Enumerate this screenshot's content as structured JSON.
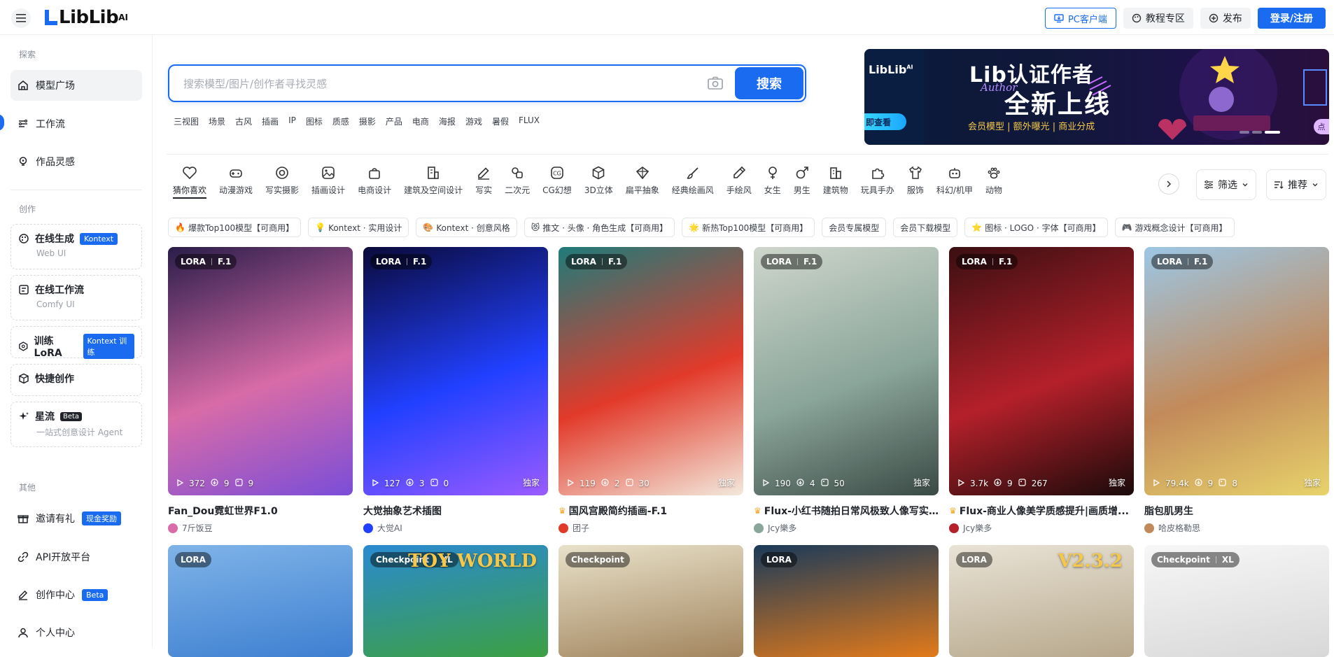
{
  "header": {
    "logo": "LibLib",
    "logo_suffix": "AI",
    "pc_client": "PC客户端",
    "tutorial": "教程专区",
    "publish": "发布",
    "login": "登录/注册"
  },
  "sidebar": {
    "section_search": "探索",
    "section_create": "创作",
    "section_other": "其他",
    "explore": [
      {
        "label": "模型广场",
        "icon": "home-icon"
      },
      {
        "label": "工作流",
        "icon": "workflow-icon"
      },
      {
        "label": "作品灵感",
        "icon": "lightbulb-icon"
      }
    ],
    "create": [
      {
        "label": "在线生成",
        "badge": "Kontext",
        "sub": "Web UI"
      },
      {
        "label": "在线工作流",
        "sub": "Comfy UI"
      },
      {
        "label": "训练LoRA",
        "badge": "Kontext 训练"
      },
      {
        "label": "快捷创作"
      },
      {
        "label": "星流",
        "badge": "Beta",
        "sub": "一站式创意设计 Agent"
      }
    ],
    "other": [
      {
        "label": "邀请有礼",
        "badge": "现金奖励"
      },
      {
        "label": "API开放平台"
      },
      {
        "label": "创作中心",
        "badge": "Beta"
      },
      {
        "label": "个人中心"
      }
    ]
  },
  "search": {
    "placeholder": "搜索模型/图片/创作者寻找灵感",
    "button": "搜索",
    "hot_tags": [
      "三视图",
      "场景",
      "古风",
      "插画",
      "IP",
      "图标",
      "质感",
      "摄影",
      "产品",
      "电商",
      "海报",
      "游戏",
      "暑假",
      "FLUX"
    ]
  },
  "banner": {
    "logo": "LibLib",
    "logo_suffix": "AI",
    "cta": "即查看",
    "title1": "Lib认证作者",
    "author": "Author",
    "title2": "全新上线",
    "subtitle": "会员模型 | 额外曝光 | 商业分成",
    "corner": "点"
  },
  "categories": [
    {
      "label": "猜你喜欢",
      "icon": "heart-icon"
    },
    {
      "label": "动漫游戏",
      "icon": "gamepad-icon"
    },
    {
      "label": "写实摄影",
      "icon": "camera-lens-icon"
    },
    {
      "label": "插画设计",
      "icon": "picture-icon"
    },
    {
      "label": "电商设计",
      "icon": "shopping-bag-icon"
    },
    {
      "label": "建筑及空间设计",
      "icon": "building-icon"
    },
    {
      "label": "写实",
      "icon": "pencil-icon"
    },
    {
      "label": "二次元",
      "icon": "shapes-icon"
    },
    {
      "label": "CG幻想",
      "icon": "cg-icon"
    },
    {
      "label": "3D立体",
      "icon": "cube-icon"
    },
    {
      "label": "扁平抽象",
      "icon": "diamond-icon"
    },
    {
      "label": "经典绘画风",
      "icon": "brush-icon"
    },
    {
      "label": "手绘风",
      "icon": "pen-icon"
    },
    {
      "label": "女生",
      "icon": "female-icon"
    },
    {
      "label": "男生",
      "icon": "male-icon"
    },
    {
      "label": "建筑物",
      "icon": "city-icon"
    },
    {
      "label": "玩具手办",
      "icon": "puzzle-icon"
    },
    {
      "label": "服饰",
      "icon": "tshirt-icon"
    },
    {
      "label": "科幻/机甲",
      "icon": "robot-icon"
    },
    {
      "label": "动物",
      "icon": "paw-icon"
    }
  ],
  "filters": {
    "filter": "筛选",
    "sort": "推荐"
  },
  "chips": [
    {
      "icon": "🔥",
      "label": "爆款Top100模型【可商用】"
    },
    {
      "icon": "💡",
      "label": "Kontext · 实用设计"
    },
    {
      "icon": "🎨",
      "label": "Kontext · 创意风格"
    },
    {
      "icon": "😻",
      "label": "推文 · 头像 · 角色生成【可商用】"
    },
    {
      "icon": "🌟",
      "label": "新热Top100模型【可商用】"
    },
    {
      "icon": "",
      "label": "会员专属模型"
    },
    {
      "icon": "",
      "label": "会员下载模型"
    },
    {
      "icon": "⭐",
      "label": "图标 · LOGO · 字体【可商用】"
    },
    {
      "icon": "🎮",
      "label": "游戏概念设计【可商用】"
    }
  ],
  "cards": [
    {
      "type": "LORA",
      "base": "F.1",
      "views": "372",
      "downloads": "9",
      "images": "9",
      "exclusive": "",
      "title": "Fan_Dou霓虹世界F1.0",
      "author": "7斤饭豆",
      "crown": false,
      "colors": [
        "#2a1d4a",
        "#d86ba8",
        "#7a4dd8"
      ]
    },
    {
      "type": "LORA",
      "base": "F.1",
      "views": "127",
      "downloads": "3",
      "images": "0",
      "exclusive": "独家",
      "title": "大觉抽象艺术插图",
      "author": "大觉AI",
      "crown": false,
      "colors": [
        "#0a0a3a",
        "#2140ff",
        "#9b5bff"
      ]
    },
    {
      "type": "LORA",
      "base": "F.1",
      "views": "119",
      "downloads": "2",
      "images": "30",
      "exclusive": "独家",
      "title": "国风宫殿简约插画-F.1",
      "author": "团子",
      "crown": true,
      "colors": [
        "#1f7b7a",
        "#e23a2a",
        "#f3e9dc"
      ]
    },
    {
      "type": "LORA",
      "base": "F.1",
      "views": "190",
      "downloads": "4",
      "images": "50",
      "exclusive": "独家",
      "title": "Flux-小红书随拍日常风极致人像写实...",
      "author": "Jcy樂多",
      "crown": true,
      "colors": [
        "#cfd6cc",
        "#8aa59a",
        "#3a4a44"
      ]
    },
    {
      "type": "LORA",
      "base": "F.1",
      "views": "3.7k",
      "downloads": "9",
      "images": "267",
      "exclusive": "独家",
      "title": "Flux-商业人像美学质感提升|画质增...",
      "author": "Jcy樂多",
      "crown": true,
      "colors": [
        "#3a0f12",
        "#b5202a",
        "#1a0a0a"
      ]
    },
    {
      "type": "LORA",
      "base": "F.1",
      "views": "79.4k",
      "downloads": "9",
      "images": "8",
      "exclusive": "独家",
      "title": "脂包肌男生",
      "author": "哈皮格勒思",
      "crown": false,
      "colors": [
        "#9cc7e6",
        "#c28a5a",
        "#e8d36b"
      ]
    }
  ],
  "cards_row2": [
    {
      "type": "LORA",
      "base": "",
      "colors": [
        "#7fb4e8",
        "#3e7fd1"
      ]
    },
    {
      "type": "Checkpoint",
      "base": "XL",
      "caption": "TOY WORLD",
      "colors": [
        "#2b8ad1",
        "#3ca043"
      ]
    },
    {
      "type": "Checkpoint",
      "base": "",
      "colors": [
        "#e8e1c9",
        "#a2855e"
      ]
    },
    {
      "type": "LORA",
      "base": "",
      "colors": [
        "#1a3a5a",
        "#e27a1a"
      ]
    },
    {
      "type": "LORA",
      "base": "",
      "caption": "V2.3.2",
      "colors": [
        "#e9e3d6",
        "#b7a88c"
      ]
    },
    {
      "type": "Checkpoint",
      "base": "XL",
      "colors": [
        "#f7f7f7",
        "#d8d8d8"
      ]
    }
  ]
}
